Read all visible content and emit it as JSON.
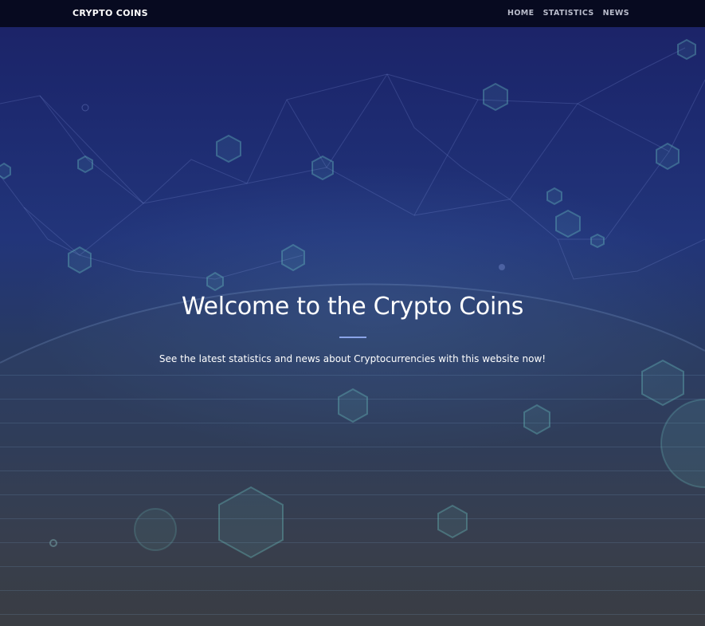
{
  "navbar": {
    "brand": "CRYPTO COINS",
    "links": [
      {
        "label": "HOME"
      },
      {
        "label": "STATISTICS"
      },
      {
        "label": "NEWS"
      }
    ]
  },
  "hero": {
    "title": "Welcome to the Crypto Coins",
    "subtitle": "See the latest statistics and news about Cryptocurrencies with this website now!"
  },
  "colors": {
    "navbar_bg": "#070a20",
    "hero_top": "#1b2266",
    "hero_bottom": "#3a3a3a",
    "divider": "#8aa4e8",
    "hex_accent": "#6ec6c4"
  }
}
